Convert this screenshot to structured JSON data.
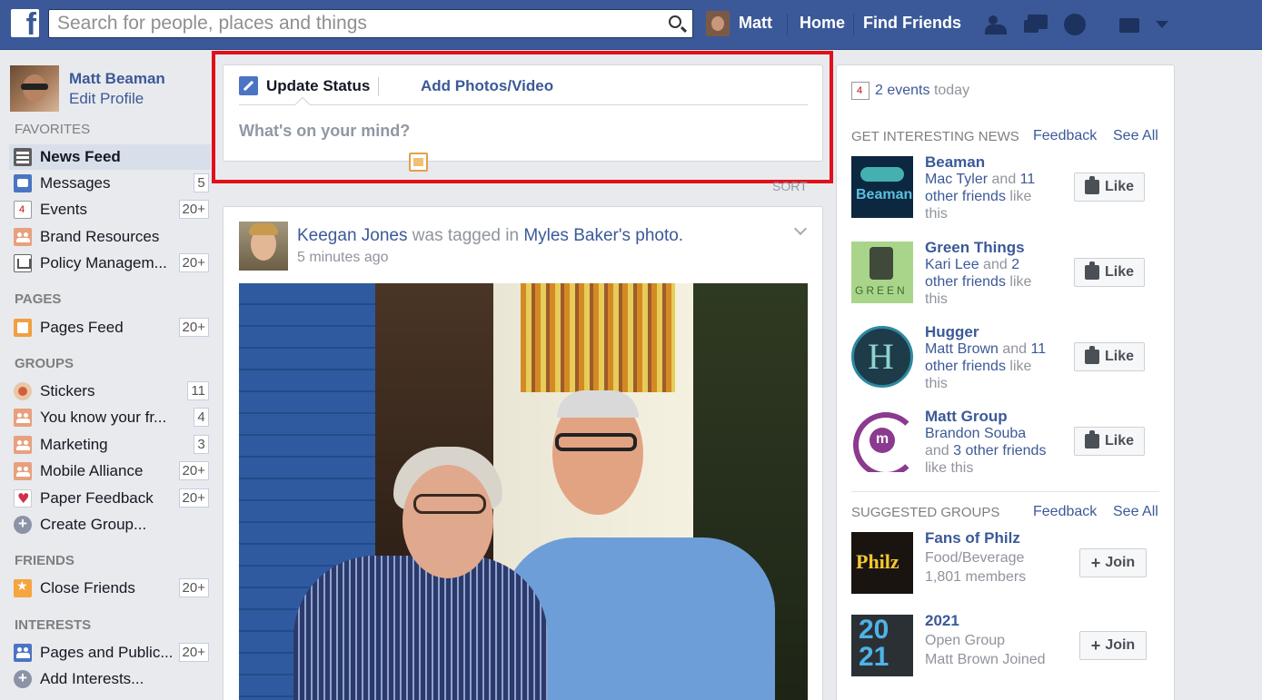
{
  "topbar": {
    "logo": "f",
    "search_placeholder": "Search for people, places and things",
    "user_name": "Matt",
    "home": "Home",
    "find_friends": "Find Friends"
  },
  "sidebar": {
    "profile_name": "Matt Beaman",
    "edit_profile": "Edit Profile",
    "favorites_header": "FAVORITES",
    "favorites": [
      {
        "label": "News Feed",
        "count": "",
        "icon": "news-feed-icon"
      },
      {
        "label": "Messages",
        "count": "5",
        "icon": "messages-icon"
      },
      {
        "label": "Events",
        "count": "20+",
        "icon": "calendar-icon"
      },
      {
        "label": "Brand Resources",
        "count": "",
        "icon": "group-icon"
      },
      {
        "label": "Policy Managem...",
        "count": "20+",
        "icon": "policy-icon"
      }
    ],
    "pages_header": "PAGES",
    "pages": [
      {
        "label": "Pages Feed",
        "count": "20+",
        "icon": "pages-feed-icon"
      }
    ],
    "groups_header": "GROUPS",
    "groups": [
      {
        "label": "Stickers",
        "count": "11",
        "icon": "stickers-icon"
      },
      {
        "label": "You know your fr...",
        "count": "4",
        "icon": "group-icon"
      },
      {
        "label": "Marketing",
        "count": "3",
        "icon": "group-icon"
      },
      {
        "label": "Mobile Alliance",
        "count": "20+",
        "icon": "group-icon"
      },
      {
        "label": "Paper Feedback",
        "count": "20+",
        "icon": "heart-icon"
      },
      {
        "label": "Create Group...",
        "count": "",
        "icon": "plus-icon"
      }
    ],
    "friends_header": "FRIENDS",
    "friends": [
      {
        "label": "Close Friends",
        "count": "20+",
        "icon": "star-icon"
      }
    ],
    "interests_header": "INTERESTS",
    "interests": [
      {
        "label": "Pages and Public...",
        "count": "20+",
        "icon": "pages-icon"
      },
      {
        "label": "Add Interests...",
        "count": "",
        "icon": "plus-icon"
      }
    ]
  },
  "composer": {
    "update_status": "Update Status",
    "add_photos": "Add Photos/Video",
    "placeholder": "What's on your mind?"
  },
  "sort_label": "SORT",
  "post": {
    "author": "Keegan Jones",
    "action": "was tagged in",
    "target": "Myles Baker's photo.",
    "time": "5 minutes ago"
  },
  "right": {
    "events_link": "2 events",
    "events_suffix": "today",
    "news_header": "GET INTERESTING NEWS",
    "feedback": "Feedback",
    "see_all": "See All",
    "like_label": "Like",
    "join_label": "Join",
    "pages": [
      {
        "name": "Beaman",
        "friend": "Mac Tyler",
        "and": "and",
        "others": "11 other friends",
        "suffix": "like this"
      },
      {
        "name": "Green Things",
        "friend": "Kari Lee",
        "and": "and",
        "others": "2 other friends",
        "suffix": "like this"
      },
      {
        "name": "Hugger",
        "friend": "Matt Brown",
        "and": "and",
        "others": "11 other friends",
        "suffix": "like this"
      },
      {
        "name": "Matt Group",
        "friend": "Brandon Souba",
        "and": "and",
        "others": "3 other friends",
        "suffix": "like this"
      }
    ],
    "groups_header": "SUGGESTED GROUPS",
    "groups": [
      {
        "name": "Fans of Philz",
        "line1": "Food/Beverage",
        "line2": "1,801 members"
      },
      {
        "name": "2021",
        "line1": "Open Group",
        "line2": "Matt Brown Joined"
      }
    ],
    "thumb_text": {
      "beaman": "Beaman",
      "green": "GREEN",
      "hugger": "H",
      "mg": "m",
      "philz": "Philz",
      "year": "20 21"
    }
  },
  "highlight_color": "#e0101c",
  "brand_color": "#3b5998"
}
